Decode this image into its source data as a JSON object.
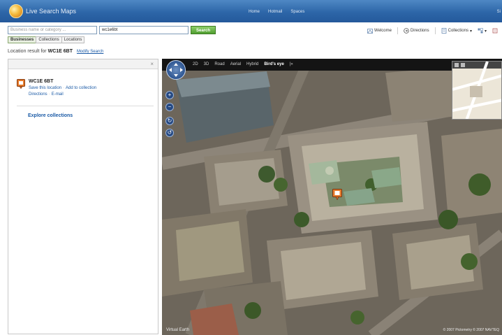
{
  "app": {
    "title": "Live Search Maps",
    "nav_links": [
      "Home",
      "Hotmail",
      "Spaces"
    ],
    "sign_in": "Si"
  },
  "search": {
    "business_placeholder": "Business name or category ...",
    "location_value": "wc1e6bt",
    "search_label": "Search",
    "tabs": [
      "Businesses",
      "Collections",
      "Locations"
    ],
    "active_tab": "Businesses"
  },
  "toolbar": {
    "welcome": "Welcome",
    "directions": "Directions",
    "collections": "Collections"
  },
  "location_line": {
    "prefix": "Location result for",
    "query": "WC1E 6BT",
    "modify": "Modify Search"
  },
  "result": {
    "title": "WC1E 6BT",
    "save": "Save this location",
    "add": "Add to collection",
    "directions": "Directions",
    "email": "E-mail",
    "explore": "Explore collections"
  },
  "map": {
    "view_modes": [
      "2D",
      "3D",
      "Road",
      "Aerial",
      "Hybrid",
      "Bird's eye"
    ],
    "active_mode": "Bird's eye",
    "compass_label": "N",
    "copyright_left": "Virtual Earth",
    "copyright_right": "© 2007 Pictometry © 2007 NAVTEQ"
  },
  "colors": {
    "header": "#2d66a8",
    "link": "#1a5aa6",
    "search_button": "#4f9e2f"
  }
}
